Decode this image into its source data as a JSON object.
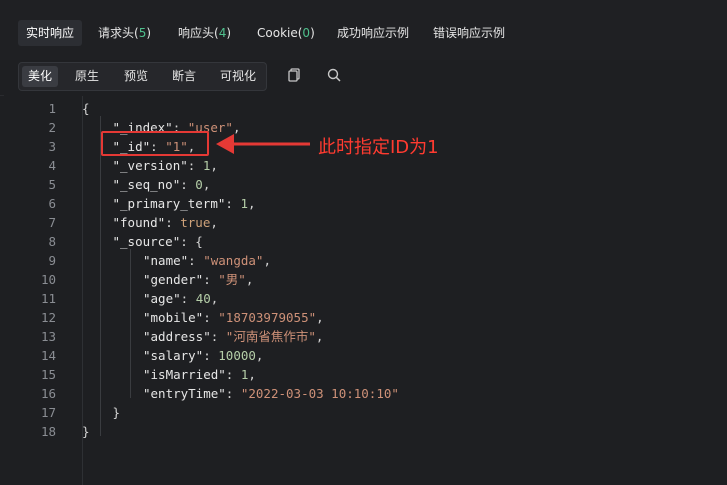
{
  "tabs": [
    {
      "label": "实时响应",
      "count": ""
    },
    {
      "label": "请求头",
      "count": "5"
    },
    {
      "label": "响应头",
      "count": "4"
    },
    {
      "label": "Cookie",
      "count": "0"
    },
    {
      "label": "成功响应示例",
      "count": ""
    },
    {
      "label": "错误响应示例",
      "count": ""
    }
  ],
  "view_modes": [
    "美化",
    "原生",
    "预览",
    "断言",
    "可视化"
  ],
  "toolbar_icons": [
    "copy-icon",
    "search-icon"
  ],
  "code": {
    "line_numbers": [
      "1",
      "2",
      "3",
      "4",
      "5",
      "6",
      "7",
      "8",
      "9",
      "10",
      "11",
      "12",
      "13",
      "14",
      "15",
      "16",
      "17",
      "18"
    ],
    "lines": [
      [
        {
          "t": "punc",
          "v": "{"
        }
      ],
      [
        {
          "t": "key",
          "v": "\"_index\""
        },
        {
          "t": "punc",
          "v": ": "
        },
        {
          "t": "str",
          "v": "\"user\""
        },
        {
          "t": "punc",
          "v": ","
        }
      ],
      [
        {
          "t": "key",
          "v": "\"_id\""
        },
        {
          "t": "punc",
          "v": ": "
        },
        {
          "t": "str",
          "v": "\"1\""
        },
        {
          "t": "punc",
          "v": ","
        }
      ],
      [
        {
          "t": "key",
          "v": "\"_version\""
        },
        {
          "t": "punc",
          "v": ": "
        },
        {
          "t": "num",
          "v": "1"
        },
        {
          "t": "punc",
          "v": ","
        }
      ],
      [
        {
          "t": "key",
          "v": "\"_seq_no\""
        },
        {
          "t": "punc",
          "v": ": "
        },
        {
          "t": "num",
          "v": "0"
        },
        {
          "t": "punc",
          "v": ","
        }
      ],
      [
        {
          "t": "key",
          "v": "\"_primary_term\""
        },
        {
          "t": "punc",
          "v": ": "
        },
        {
          "t": "num",
          "v": "1"
        },
        {
          "t": "punc",
          "v": ","
        }
      ],
      [
        {
          "t": "key",
          "v": "\"found\""
        },
        {
          "t": "punc",
          "v": ": "
        },
        {
          "t": "bool",
          "v": "true"
        },
        {
          "t": "punc",
          "v": ","
        }
      ],
      [
        {
          "t": "key",
          "v": "\"_source\""
        },
        {
          "t": "punc",
          "v": ": {"
        }
      ],
      [
        {
          "t": "key",
          "v": "\"name\""
        },
        {
          "t": "punc",
          "v": ": "
        },
        {
          "t": "str",
          "v": "\"wangda\""
        },
        {
          "t": "punc",
          "v": ","
        }
      ],
      [
        {
          "t": "key",
          "v": "\"gender\""
        },
        {
          "t": "punc",
          "v": ": "
        },
        {
          "t": "str",
          "v": "\"男\""
        },
        {
          "t": "punc",
          "v": ","
        }
      ],
      [
        {
          "t": "key",
          "v": "\"age\""
        },
        {
          "t": "punc",
          "v": ": "
        },
        {
          "t": "num",
          "v": "40"
        },
        {
          "t": "punc",
          "v": ","
        }
      ],
      [
        {
          "t": "key",
          "v": "\"mobile\""
        },
        {
          "t": "punc",
          "v": ": "
        },
        {
          "t": "str",
          "v": "\"18703979055\""
        },
        {
          "t": "punc",
          "v": ","
        }
      ],
      [
        {
          "t": "key",
          "v": "\"address\""
        },
        {
          "t": "punc",
          "v": ": "
        },
        {
          "t": "str",
          "v": "\"河南省焦作市\""
        },
        {
          "t": "punc",
          "v": ","
        }
      ],
      [
        {
          "t": "key",
          "v": "\"salary\""
        },
        {
          "t": "punc",
          "v": ": "
        },
        {
          "t": "num",
          "v": "10000"
        },
        {
          "t": "punc",
          "v": ","
        }
      ],
      [
        {
          "t": "key",
          "v": "\"isMarried\""
        },
        {
          "t": "punc",
          "v": ": "
        },
        {
          "t": "num",
          "v": "1"
        },
        {
          "t": "punc",
          "v": ","
        }
      ],
      [
        {
          "t": "key",
          "v": "\"entryTime\""
        },
        {
          "t": "punc",
          "v": ": "
        },
        {
          "t": "str",
          "v": "\"2022-03-03 10:10:10\""
        }
      ],
      [
        {
          "t": "punc",
          "v": "}"
        }
      ],
      [
        {
          "t": "punc",
          "v": "}"
        }
      ]
    ]
  },
  "annotation": {
    "text": "此时指定ID为1",
    "color": "#ff3b30"
  },
  "colors": {
    "accent_count": "#4fc08d",
    "string": "#ce9178",
    "number": "#b5cea8"
  }
}
